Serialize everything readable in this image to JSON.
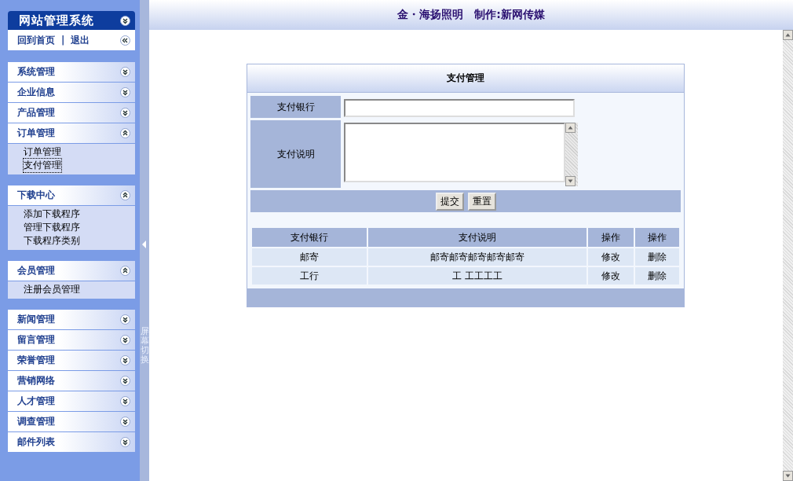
{
  "sidebar": {
    "title": "网站管理系统",
    "links": [
      {
        "label": "回到首页"
      },
      {
        "label": "退出"
      }
    ],
    "separator": "|",
    "sections": [
      {
        "groups": [
          {
            "label": "系统管理",
            "expanded": false
          },
          {
            "label": "企业信息",
            "expanded": false
          },
          {
            "label": "产品管理",
            "expanded": false
          },
          {
            "label": "订单管理",
            "expanded": true,
            "children": [
              {
                "label": "订单管理",
                "selected": false
              },
              {
                "label": "支付管理",
                "selected": true
              }
            ]
          }
        ]
      },
      {
        "groups": [
          {
            "label": "下载中心",
            "expanded": true,
            "children": [
              {
                "label": "添加下载程序",
                "selected": false
              },
              {
                "label": "管理下载程序",
                "selected": false
              },
              {
                "label": "下载程序类别",
                "selected": false
              }
            ]
          }
        ]
      },
      {
        "groups": [
          {
            "label": "会员管理",
            "expanded": true,
            "children": [
              {
                "label": "注册会员管理",
                "selected": false
              }
            ]
          }
        ]
      },
      {
        "groups": [
          {
            "label": "新闻管理",
            "expanded": false
          },
          {
            "label": "留言管理",
            "expanded": false
          },
          {
            "label": "荣誉管理",
            "expanded": false
          },
          {
            "label": "营销网络",
            "expanded": false
          },
          {
            "label": "人才管理",
            "expanded": false
          },
          {
            "label": "调查管理",
            "expanded": false
          },
          {
            "label": "邮件列表",
            "expanded": false
          }
        ]
      }
    ]
  },
  "splitter": {
    "label": "屏幕切换"
  },
  "header": {
    "title": "金・海扬照明　制作:新网传媒"
  },
  "panel": {
    "title": "支付管理",
    "form": {
      "fields": [
        {
          "label": "支付银行",
          "kind": "input"
        },
        {
          "label": "支付说明",
          "kind": "textarea"
        }
      ],
      "buttons": [
        "提交",
        "重置"
      ]
    },
    "table": {
      "columns": [
        "支付银行",
        "支付说明",
        "操作",
        "操作"
      ],
      "rows": [
        [
          "邮寄",
          "邮寄邮寄邮寄邮寄邮寄",
          "修改",
          "删除"
        ],
        [
          "工行",
          "工 工工工工",
          "修改",
          "删除"
        ]
      ]
    }
  }
}
